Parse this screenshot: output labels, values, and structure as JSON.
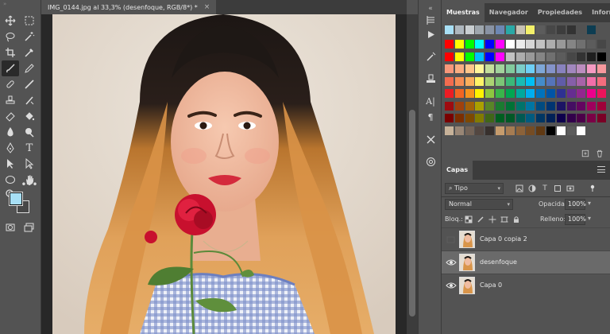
{
  "document": {
    "tab_title": "IMG_0144.jpg al 33,3% (desenfoque, RGB/8*) *",
    "close_glyph": "×"
  },
  "toolbar": {
    "tools": [
      "move-tool",
      "marquee-tool",
      "lasso-tool",
      "magic-wand-tool",
      "crop-tool",
      "frame-tool",
      "eyedropper-tool",
      "brush-tool",
      "healing-tool",
      "paint-brush-tool",
      "clone-stamp-tool",
      "history-brush-tool",
      "eraser-tool",
      "paint-bucket-tool",
      "blur-tool",
      "dodge-tool",
      "pen-tool",
      "type-tool",
      "path-selection-tool",
      "direct-selection-tool",
      "ellipse-tool",
      "hand-tool",
      "zoom-tool",
      "more-tools"
    ],
    "type_tool_glyph": "T",
    "foreground_color": "#a7dff5",
    "background_color": "#474747"
  },
  "swatches_panel": {
    "tabs": [
      "Muestras",
      "Navegador",
      "Propiedades",
      "Información"
    ],
    "active_tab": "Muestras",
    "recent": [
      "#a7dff5",
      "#aeb7be",
      "#c9ced1",
      "#9fa7ae",
      "#8993a4",
      "#6d87b3",
      "#2aa9a6",
      "#c7c1b4",
      "#f3f06a",
      "#5c5c5c",
      "#474747",
      "#3d3d3d",
      "#333333",
      "#525252",
      "#0d3d52"
    ],
    "grid": [
      [
        "#ff0000",
        "#ffff00",
        "#00ff00",
        "#00ffff",
        "#0000ff",
        "#ff00ff",
        "#ffffff",
        "#ebebeb",
        "#d6d6d6",
        "#c2c2c2",
        "#adadad",
        "#999999",
        "#858585",
        "#707070",
        "#5c5c5c",
        "#474747"
      ],
      [
        "#ff0000",
        "#ffff00",
        "#00ff00",
        "#00c0ff",
        "#0000ff",
        "#ff00ff",
        "#c2c2c2",
        "#adadad",
        "#999999",
        "#858585",
        "#707070",
        "#5c5c5c",
        "#474747",
        "#333333",
        "#1f1f1f",
        "#000000"
      ],
      [
        "#f7977a",
        "#f9ad81",
        "#fdc68a",
        "#fff79a",
        "#c4df9b",
        "#a2d39c",
        "#82ca9d",
        "#7bcdc8",
        "#6ecff6",
        "#7ea7d8",
        "#8493ca",
        "#8882be",
        "#a187be",
        "#bc8dbf",
        "#f49ac2",
        "#f6989d"
      ],
      [
        "#f26c4f",
        "#f68e55",
        "#fbaf5c",
        "#fff467",
        "#acd372",
        "#7cc576",
        "#3bb878",
        "#1abbb4",
        "#00bff3",
        "#438cca",
        "#5574b9",
        "#605ca8",
        "#855fa8",
        "#a763a8",
        "#f06ea9",
        "#f26d7d"
      ],
      [
        "#ed1c24",
        "#f26522",
        "#f7941d",
        "#fff200",
        "#8dc73f",
        "#39b54a",
        "#00a651",
        "#00a99d",
        "#00aeef",
        "#0072bc",
        "#0054a6",
        "#2e3192",
        "#662d91",
        "#92278f",
        "#ec008c",
        "#ed145b"
      ],
      [
        "#9e0b0f",
        "#a0410d",
        "#a36209",
        "#aba000",
        "#598527",
        "#1a7b30",
        "#007236",
        "#00746b",
        "#0076a3",
        "#004b80",
        "#003471",
        "#1b1464",
        "#440e62",
        "#630460",
        "#9e005d",
        "#9e0039"
      ],
      [
        "#790000",
        "#7b2e00",
        "#7d4900",
        "#827b00",
        "#406618",
        "#005e20",
        "#005826",
        "#005952",
        "#005b7f",
        "#003663",
        "#002157",
        "#0d004c",
        "#32004b",
        "#4b0049",
        "#7b0046",
        "#7a0026"
      ],
      [
        "#c7b299",
        "#998675",
        "#736357",
        "#534741",
        "#37302d",
        "#c69c6d",
        "#a67c52",
        "#8c6239",
        "#754c24",
        "#603913",
        "#000000",
        "#ffffff",
        "#5c5c5c",
        "#ffffff"
      ]
    ]
  },
  "layers_panel": {
    "tabs": [
      "Capas"
    ],
    "active_tab": "Capas",
    "filter_kind": "Tipo",
    "blend_mode": "Normal",
    "opacity_label": "Opacidad:",
    "opacity_value": "100%",
    "lock_label": "Bloq.:",
    "fill_label": "Relleno:",
    "fill_value": "100%",
    "layers": [
      {
        "name": "Capa 0 copia 2",
        "visible": false,
        "selected": false
      },
      {
        "name": "desenfoque",
        "visible": true,
        "selected": true
      },
      {
        "name": "Capa 0",
        "visible": true,
        "selected": false
      }
    ]
  }
}
